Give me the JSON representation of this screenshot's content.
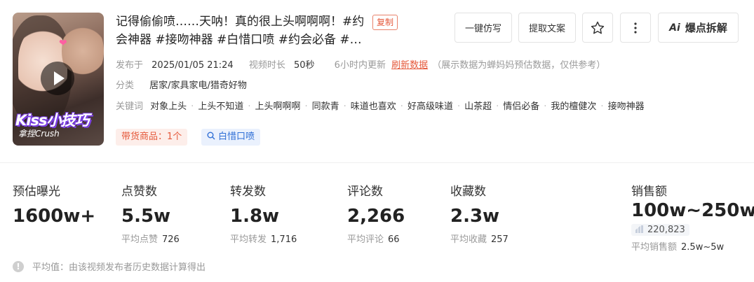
{
  "video": {
    "title": "记得偷偷喷……天呐！真的很上头啊啊啊！#约会神器 #接吻神器 #白惜口喷 #约会必备 #恋爱",
    "copy_label": "复制",
    "thumbnail_text": "Kiss小技巧",
    "thumbnail_subtext": "拿捏Crush"
  },
  "actions": {
    "imitate": "一键仿写",
    "extract": "提取文案",
    "ai_breakdown": "爆点拆解",
    "ai_badge": "Ai"
  },
  "meta": {
    "publish_label": "发布于",
    "publish_time": "2025/01/05 21:24",
    "duration_label": "视频时长",
    "duration": "50秒",
    "update_note": "6小时内更新",
    "refresh_label": "刷新数据",
    "estimate_note": "（展示数据为蝉妈妈预估数据，仅供参考）",
    "category_label": "分类",
    "category": "居家/家具家电/猎奇好物",
    "keywords_label": "关键词",
    "keywords": [
      "对象上头",
      "上头不知道",
      "上头啊啊啊",
      "同款青",
      "味道也喜欢",
      "好高级味道",
      "山茶超",
      "情侣必备",
      "我的檀健次",
      "接吻神器"
    ]
  },
  "chips": {
    "goods": "带货商品：1个",
    "search": "白惜口喷"
  },
  "stats": {
    "exposure": {
      "label": "预估曝光",
      "value": "1600w+"
    },
    "likes": {
      "label": "点赞数",
      "value": "5.5w",
      "avg_label": "平均点赞",
      "avg": "726"
    },
    "shares": {
      "label": "转发数",
      "value": "1.8w",
      "avg_label": "平均转发",
      "avg": "1,716"
    },
    "comments": {
      "label": "评论数",
      "value": "2,266",
      "avg_label": "平均评论",
      "avg": "66"
    },
    "favorites": {
      "label": "收藏数",
      "value": "2.3w",
      "avg_label": "平均收藏",
      "avg": "257"
    },
    "sales": {
      "label": "销售额",
      "value": "100w~250w",
      "count": "220,823",
      "avg_label": "平均销售额",
      "avg": "2.5w~5w"
    }
  },
  "footnote": "平均值：由该视频发布者历史数据计算得出",
  "colors": {
    "accent": "#e5593b",
    "link_blue": "#2f6fd6",
    "muted": "#999999"
  }
}
